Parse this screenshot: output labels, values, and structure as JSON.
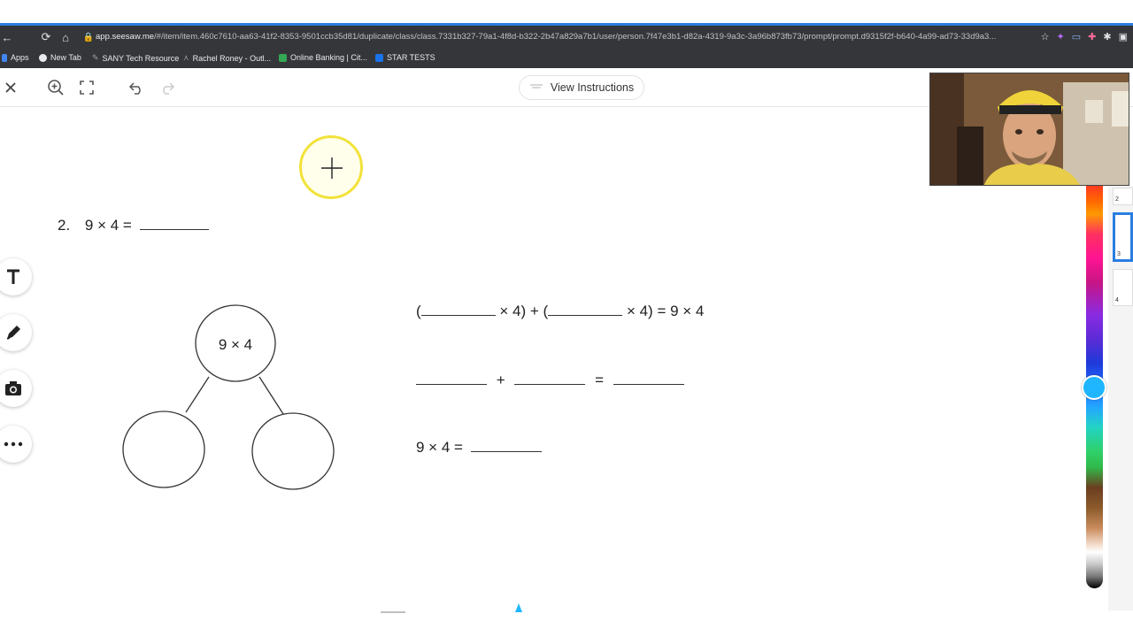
{
  "browser": {
    "url_host": "app.seesaw.me",
    "url_path": "/#/item/item.460c7610-aa63-41f2-8353-9501ccb35d81/duplicate/class/class.7331b327-79a1-4f8d-b322-2b47a829a7b1/user/person.7f47e3b1-d82a-4319-9a3c-3a96b873fb73/prompt/prompt.d9315f2f-b640-4a99-ad73-33d9a3..."
  },
  "bookmarks": [
    {
      "label": "Apps",
      "color": "#4285f4"
    },
    {
      "label": "New Tab",
      "color": "#e8eaed"
    },
    {
      "label": "SANY Tech Resource",
      "color": "#9aa0a6"
    },
    {
      "label": "Rachel Roney - Outl...",
      "color": "#9aa0a6"
    },
    {
      "label": "Online Banking | Cit...",
      "color": "#34a853"
    },
    {
      "label": "STAR TESTS",
      "color": "#1a73e8"
    }
  ],
  "toolbar": {
    "view_instructions": "View Instructions"
  },
  "worksheet": {
    "problem_number": "2.",
    "problem_expr": "9 × 4 =",
    "bond_top": "9 × 4",
    "eq1_parts": [
      "(",
      "× 4) + (",
      "× 4) = 9 × 4"
    ],
    "eq2_plus": "+",
    "eq2_equals": "=",
    "eq3_expr": "9 × 4 ="
  },
  "pages": [
    {
      "num": "2"
    },
    {
      "num": "3"
    },
    {
      "num": "4"
    }
  ],
  "colors": {
    "accent": "#2a7de1",
    "palette_selected": "#1fb6ff",
    "cursor_highlight": "#f2e23a"
  },
  "icons": {
    "close": "close-icon",
    "zoom": "zoom-in-icon",
    "fullscreen": "fullscreen-icon",
    "undo": "undo-icon",
    "redo": "redo-icon",
    "text_tool": "text-tool-icon",
    "pen_tool": "pen-icon",
    "camera_tool": "camera-icon",
    "more_tools": "more-icon"
  }
}
